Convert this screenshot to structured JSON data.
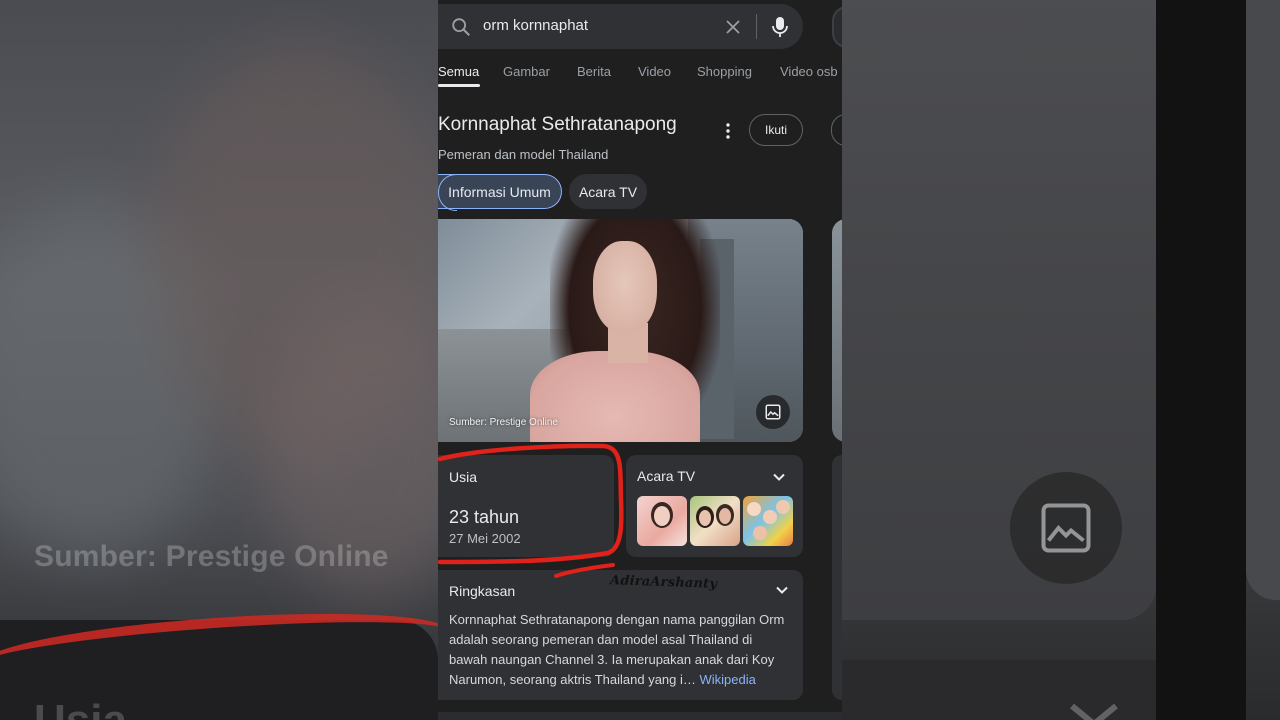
{
  "search": {
    "query": "orm kornnaphat"
  },
  "tabs": [
    {
      "label": "Semua",
      "active": true
    },
    {
      "label": "Gambar",
      "active": false
    },
    {
      "label": "Berita",
      "active": false
    },
    {
      "label": "Video",
      "active": false
    },
    {
      "label": "Shopping",
      "active": false
    },
    {
      "label": "Video osb",
      "active": false
    }
  ],
  "knowledge_panel": {
    "title": "Kornnaphat Sethratanapong",
    "subtitle": "Pemeran dan model Thailand",
    "follow_label": "Ikuti",
    "chips": [
      "Informasi Umum",
      "Acara TV"
    ],
    "image_source": "Sumber: Prestige Online"
  },
  "age_card": {
    "label": "Usia",
    "value": "23 tahun",
    "birthdate": "27 Mei 2002"
  },
  "tv_card": {
    "label": "Acara TV"
  },
  "summary_card": {
    "label": "Ringkasan",
    "text": "Kornnaphat Sethratanapong dengan nama panggilan Orm adalah seorang pemeran dan model asal Thailand di bawah naungan Channel 3. Ia merupakan anak dari Koy Narumon, seorang aktris Thailand yang i…",
    "link": "Wikipedia"
  },
  "watermark": "AdiraArshanty",
  "background": {
    "source_text": "Sumber: Prestige Online",
    "usia_text": "Usia"
  },
  "colors": {
    "accent": "#8ab4f8",
    "annotation": "#e0221b",
    "surface": "#2f3135",
    "page": "#1f1f1f"
  }
}
